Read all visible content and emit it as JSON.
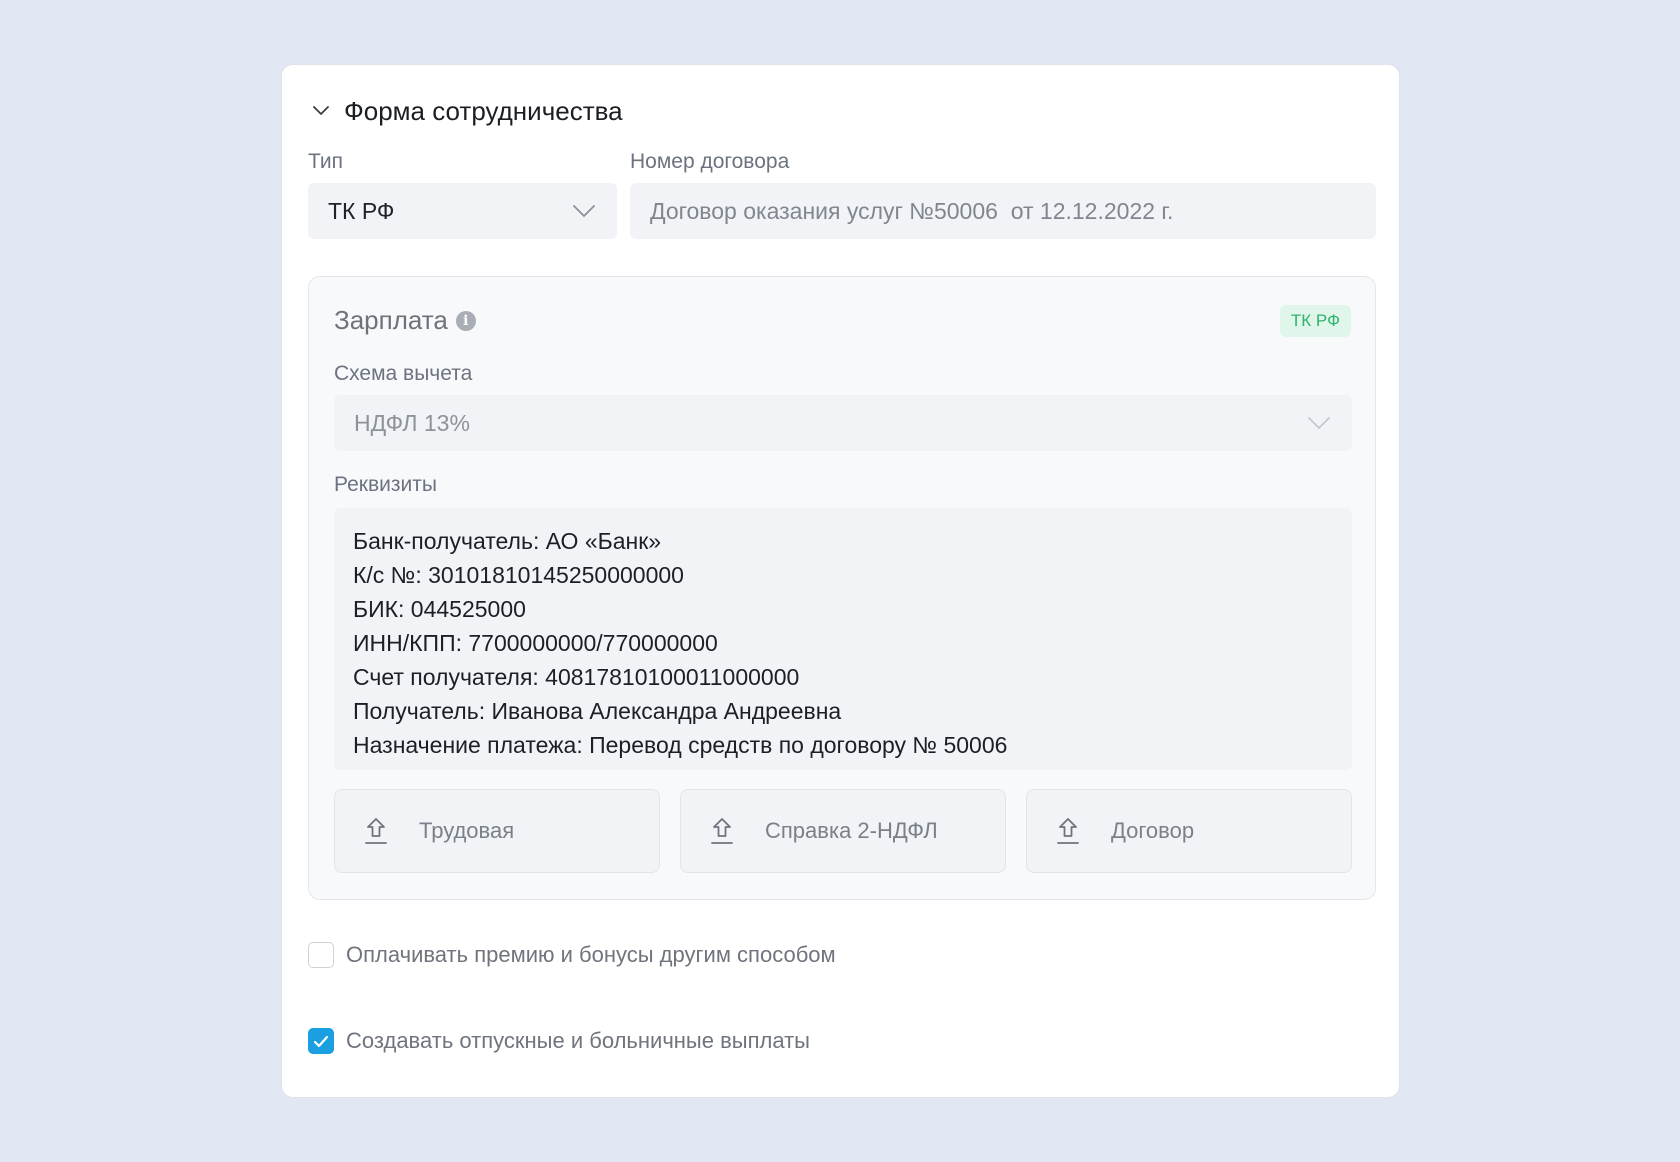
{
  "section": {
    "title": "Форма сотрудничества"
  },
  "type_field": {
    "label": "Тип",
    "value": "ТК РФ"
  },
  "contract_field": {
    "label": "Номер договора",
    "value": "Договор оказания услуг №50006  от 12.12.2022 г."
  },
  "salary": {
    "title": "Зарплата",
    "badge": "ТК РФ",
    "badge_color": "#2fb36d",
    "deduction_label": "Схема вычета",
    "deduction_value": "НДФЛ 13%",
    "requisites_label": "Реквизиты",
    "requisites": [
      "Банк-получатель: АО «Банк»",
      "К/с №: 30101810145250000000",
      "БИК: 044525000",
      "ИНН/КПП: 7700000000/770000000",
      "Счет получателя: 40817810100011000000",
      "Получатель: Иванова Александра Андреевна",
      "Назначение платежа: Перевод средств по договору № 50006"
    ],
    "uploads": [
      {
        "label": "Трудовая",
        "icon": "upload-icon"
      },
      {
        "label": "Справка 2-НДФЛ",
        "icon": "upload-icon"
      },
      {
        "label": "Договор",
        "icon": "upload-icon"
      }
    ]
  },
  "options": [
    {
      "label": "Оплачивать премию и бонусы другим способом",
      "checked": false
    },
    {
      "label": "Создавать отпускные и больничные выплаты",
      "checked": true
    }
  ],
  "colors": {
    "accent": "#1a9fe0",
    "background": "#e1e7f3"
  }
}
